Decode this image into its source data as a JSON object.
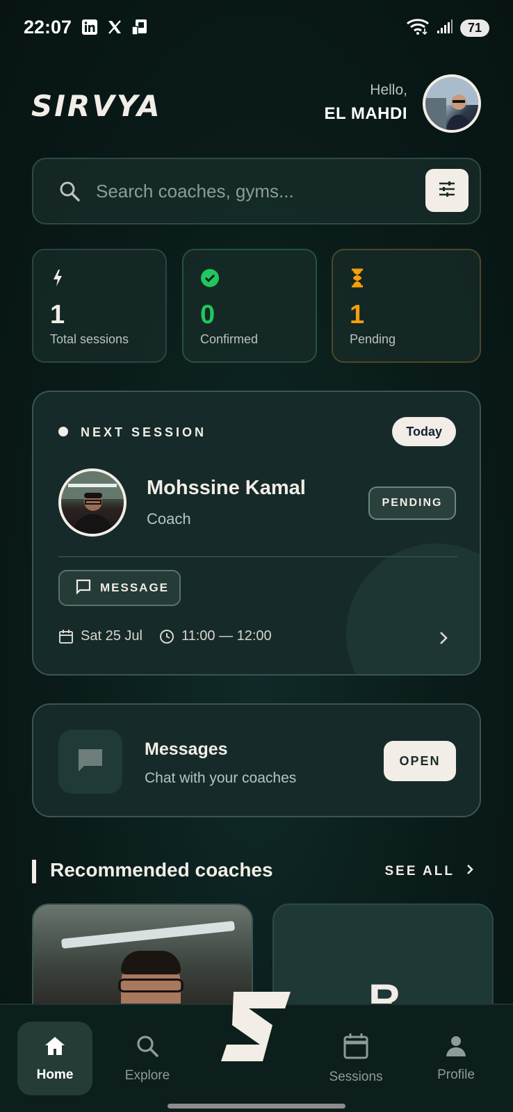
{
  "status_bar": {
    "time": "22:07",
    "notification_icons": [
      "linkedin-icon",
      "x-icon",
      "sim-icon"
    ],
    "battery": "71"
  },
  "header": {
    "logo": "SIRVYA",
    "greeting": "Hello,",
    "user_name": "EL MAHDI"
  },
  "search": {
    "placeholder": "Search coaches, gyms..."
  },
  "stats": [
    {
      "value": "1",
      "label": "Total sessions",
      "color": "#f2ede6"
    },
    {
      "value": "0",
      "label": "Confirmed",
      "color": "#22c55e"
    },
    {
      "value": "1",
      "label": "Pending",
      "color": "#f59e0b"
    }
  ],
  "next_session": {
    "heading": "NEXT SESSION",
    "day_badge": "Today",
    "coach_name": "Mohssine Kamal",
    "coach_role": "Coach",
    "status": "PENDING",
    "message_label": "MESSAGE",
    "date": "Sat 25 Jul",
    "time": "11:00 — 12:00"
  },
  "messages_card": {
    "title": "Messages",
    "subtitle": "Chat with your coaches",
    "button": "OPEN"
  },
  "recommended": {
    "title": "Recommended coaches",
    "see_all": "SEE ALL",
    "second_card_initial": "R"
  },
  "bottom_nav": {
    "home": "Home",
    "explore": "Explore",
    "sessions": "Sessions",
    "profile": "Profile"
  }
}
